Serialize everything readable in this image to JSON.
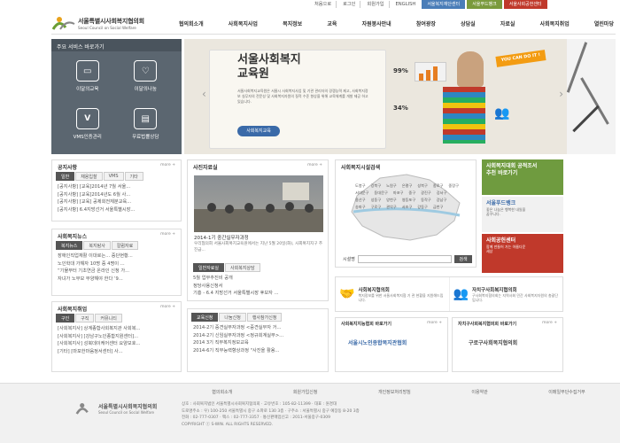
{
  "util": {
    "links": [
      "처음으로",
      "로그인",
      "회원가입",
      "ENGLISH"
    ],
    "buttons": [
      {
        "label": "서울복지재단센터",
        "color": "#4a7db8"
      },
      {
        "label": "서울푸드뱅크",
        "color": "#7a9a3c"
      },
      {
        "label": "서울사회공헌센터",
        "color": "#c0392b"
      }
    ]
  },
  "logo": {
    "kr": "서울특별시사회복지협의회",
    "en": "Seoul Council on Social Welfare"
  },
  "gnb": [
    "협의회소개",
    "사회복지사업",
    "복지정보",
    "교육",
    "자원봉사안내",
    "참여광장",
    "상담실",
    "자료실",
    "사회복지취업",
    "열린마당"
  ],
  "quick": {
    "title": "주요 서비스 바로가기",
    "items": [
      {
        "label": "이달의교육",
        "icon": "monitor-icon"
      },
      {
        "label": "이달의나눔",
        "icon": "heart-icon"
      },
      {
        "label": "VMS인증관리",
        "icon": "vms-icon"
      },
      {
        "label": "무료법률상담",
        "icon": "law-book-icon"
      }
    ]
  },
  "banner": {
    "title_line1": "서울사회복지",
    "title_line2": "교육원",
    "desc": "서울사회복지교육원은 서울시 사회복지사업 및 기관 관리자의 경쟁능력 제고, 사회복지정보 실무자의 전문성 및 사회복지자원의 질적 수준 향상을 위해 교육체계를 개발 제공 하고 있습니다.",
    "button": "사회복지교육",
    "badge": "YOU CAN DO IT !",
    "stat1": "99%",
    "stat2": "34%"
  },
  "notice": {
    "title": "공지사항",
    "more": "more +",
    "tabs": [
      "일반",
      "채용입찰",
      "VMS",
      "기타"
    ],
    "items": [
      "[공지사항] [교육]2014년 7월 서울...",
      "[공지사항] [교육]2014년도 6월 사...",
      "[공지사항] [교육] 공제회전체분교육...",
      "[공지사항] 6.4지방선거 서울특별시장..."
    ]
  },
  "welfare_news": {
    "title": "사회복지뉴스",
    "more": "more +",
    "tabs": [
      "복지뉴스",
      "복지탐사",
      "칼럼자료"
    ],
    "items": [
      "장애인직업재활 이대로는... 중단현황...",
      "노인학대 가해자 10명 중 4명이 ...",
      "“기물부터 기초연금 온라인 신청 가...",
      "자녀가 노부모 부양해야 한다 ‘9..."
    ]
  },
  "jobs": {
    "title": "사회복지취업",
    "more": "more +",
    "tabs": [
      "구인",
      "구직",
      "커뮤니티"
    ],
    "items": [
      "[사회복지사] 상계종합사회복지관 사회복...",
      "[사회복지사] [강남구노인종합지원센터]...",
      "[사회복지사] 성북데이케어센터 요양보호...",
      "[기타] [마포한마음정서센터] 사..."
    ]
  },
  "photo_news": {
    "title": "사진자료실",
    "more": "more +",
    "caption_title": "2014-1기 중간실무자과정",
    "caption_body": "우리협의회 서울사회복지교육원에서는 지난 5월 20일(화), 사회복지지구 추진급...",
    "tabs": [
      "일반자료실",
      "사회복지상담"
    ],
    "items": [
      "5월 업무추진비 공개",
      "정당사용신청서",
      "기흥 - 6.4 지방선거 서울특별시장 후보자 ..."
    ]
  },
  "education": {
    "tabs": [
      "교육신청",
      "나눔신청",
      "행사참가신청"
    ],
    "items": [
      "2014-2기 중견실무자과정 <중견실무자 거...",
      "2014-2기 신임실무자과정 <정규회계실무>...",
      "2014 3기 직무복지정보교육",
      "2014-6기 직무능력향상과정 \"사진을 활용..."
    ]
  },
  "facility": {
    "title": "사회복지시설검색",
    "districts": [
      "도봉구",
      "강북구",
      "노원구",
      "은평구",
      "성북구",
      "종로구",
      "중랑구",
      "서대문구",
      "동대문구",
      "마포구",
      "중구",
      "광진구",
      "강서구",
      "용산구",
      "성동구",
      "양천구",
      "영등포구",
      "동작구",
      "강남구",
      "송파구",
      "구로구",
      "관악구",
      "서초구",
      "강동구",
      "금천구"
    ],
    "search_label": "시설명",
    "search_placeholder": "",
    "search_button": "검색"
  },
  "side_banners": [
    {
      "title": "사회복지대회 공적조서 추천 바로가기",
      "sub": "",
      "bg": "#6f9b3f",
      "color": "#fff"
    },
    {
      "title": "서울푸드뱅크",
      "sub": "좋은 나눔은 행복한 내일을 꿈꾸니다.",
      "bg": "#f1f1f1",
      "color": "#3a6aa8"
    },
    {
      "title": "사회공헌센터",
      "sub": "함께 만들어 가는 아름다운 세상",
      "bg": "#c0392b",
      "color": "#fff"
    }
  ],
  "network": [
    {
      "title": "사회복지협의회",
      "desc": "복지정보를 위한 서울사회복지협 기 관 현황을 지원해드립니다.",
      "icon": "handshake-icon"
    },
    {
      "title": "자치구사회복지협의회",
      "desc": "구사회복지협의회는 지역사회 민간 사회복지자원의 총괄단 입니다.",
      "icon": "people-icon"
    }
  ],
  "shortcuts": [
    {
      "title": "사회복지지능협회 바로가기",
      "org": "서울시노인종합복지관협회",
      "more": "more +"
    },
    {
      "title": "자치구사회복지협의회 바로가기",
      "org": "구로구사회복지협의회",
      "more": "more +"
    }
  ],
  "footer": {
    "nav": [
      "협의회소개",
      "회원가입신청",
      "개인정보처리방침",
      "이용약관",
      "이메일무단수집거부"
    ],
    "addr_lines": [
      "상호 : 사회복지법인 서울특별시사회복지협의회 · 고유번호 : 105-82-11399 · 대표 : 원경대",
      "도로명주소 : 우) 100-250 서울특별시 중구 소파로 130 3층 · 구주소 : 서울특별시 중구 예장동 8-20 3층",
      "전화 : 02-777-0307 · 팩스 : 02-777-3357 · 통신판매업신고 : 2011-서울중구-0309",
      "COPYRIGHT ⓒ S-WIN. ALL RIGHTS RESERVED."
    ],
    "logo_kr": "서울특별시사회복지협의회",
    "logo_en": "Seoul Council on Social Welfare"
  }
}
